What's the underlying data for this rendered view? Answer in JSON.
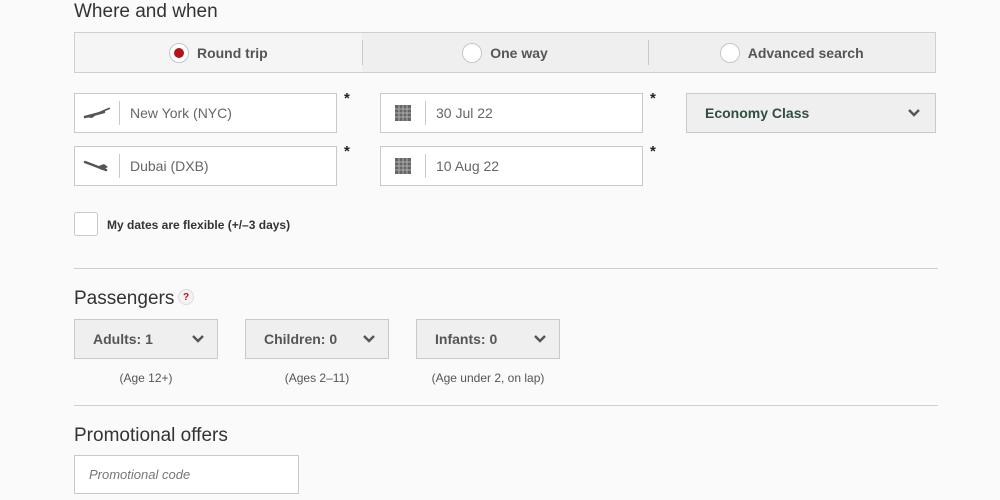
{
  "sections": {
    "where_when": "Where and when",
    "passengers": "Passengers",
    "promo": "Promotional offers"
  },
  "trip_types": [
    {
      "label": "Round trip",
      "selected": true
    },
    {
      "label": "One way",
      "selected": false
    },
    {
      "label": "Advanced search",
      "selected": false
    }
  ],
  "fields": {
    "origin": {
      "value": "New York (NYC)",
      "icon": "plane-takeoff-icon"
    },
    "destination": {
      "value": "Dubai (DXB)",
      "icon": "plane-landing-icon"
    },
    "depart_date": {
      "value": "30 Jul 22",
      "icon": "calendar-icon"
    },
    "return_date": {
      "value": "10 Aug 22",
      "icon": "calendar-icon"
    },
    "required_marker": "*"
  },
  "cabin_class": {
    "selected": "Economy Class",
    "color": "#2f4f3f"
  },
  "flexible_dates": {
    "label": "My dates are flexible (+/–3 days)",
    "checked": false
  },
  "passengers_help": "?",
  "passengers": [
    {
      "label": "Adults: 1",
      "note": "(Age 12+)"
    },
    {
      "label": "Children: 0",
      "note": "(Ages 2–11)"
    },
    {
      "label": "Infants: 0",
      "note": "(Age under 2, on lap)"
    }
  ],
  "promo_code": {
    "value": "",
    "placeholder": "Promotional code"
  },
  "colors": {
    "accent": "#b5121b",
    "field_bg": "#ffffff",
    "select_bg": "#efefef"
  }
}
